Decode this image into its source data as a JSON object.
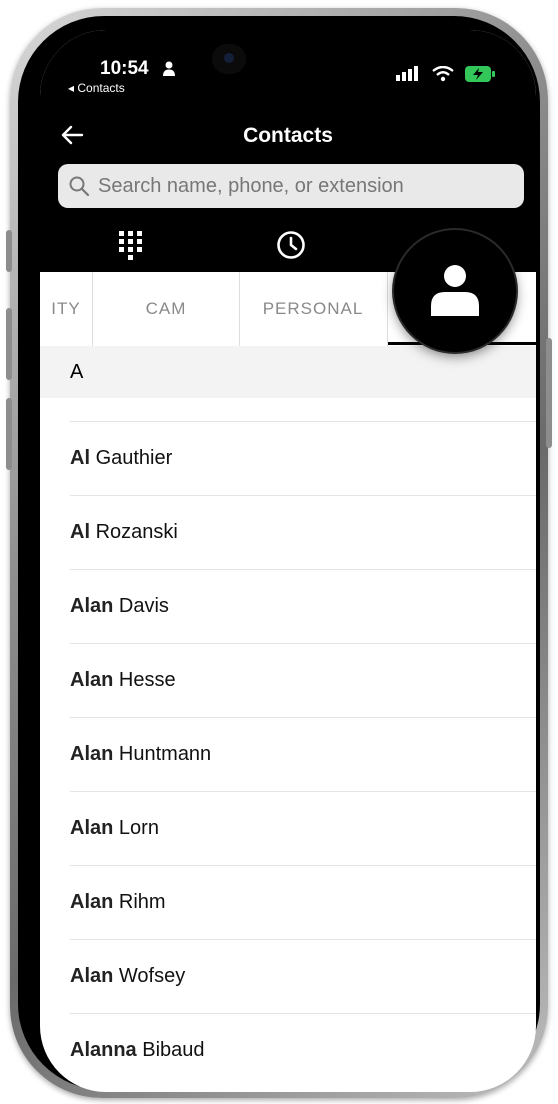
{
  "status": {
    "time": "10:54",
    "back_label": "◂ Contacts"
  },
  "header": {
    "title": "Contacts"
  },
  "search": {
    "placeholder": "Search name, phone, or extension"
  },
  "tabs": [
    {
      "name": "dialpad",
      "icon": "dialpad-icon"
    },
    {
      "name": "recent",
      "icon": "clock-icon"
    },
    {
      "name": "contacts",
      "icon": "person-icon",
      "active": true
    }
  ],
  "subtabs": [
    "ITY",
    "CAM",
    "PERSONAL"
  ],
  "section": {
    "letter": "A"
  },
  "contacts": [
    {
      "first": "Al",
      "last": "Gauthier"
    },
    {
      "first": "Al",
      "last": "Rozanski"
    },
    {
      "first": "Alan",
      "last": "Davis"
    },
    {
      "first": "Alan",
      "last": "Hesse"
    },
    {
      "first": "Alan",
      "last": "Huntmann"
    },
    {
      "first": "Alan",
      "last": "Lorn"
    },
    {
      "first": "Alan",
      "last": "Rihm"
    },
    {
      "first": "Alan",
      "last": "Wofsey"
    },
    {
      "first": "Alanna",
      "last": "Bibaud"
    }
  ],
  "colors": {
    "header_bg": "#000000",
    "search_bg": "#e9e9ea",
    "battery": "#33c759"
  }
}
